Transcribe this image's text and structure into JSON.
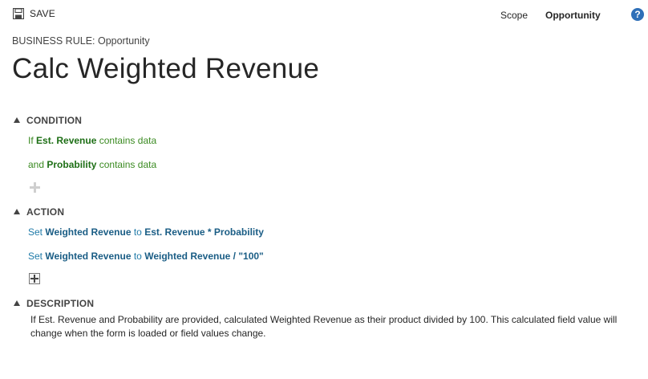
{
  "toolbar": {
    "save_label": "SAVE",
    "scope_label": "Scope",
    "scope_value": "Opportunity",
    "help_label": "?"
  },
  "breadcrumb": "BUSINESS RULE: Opportunity",
  "title": "Calc Weighted Revenue",
  "condition": {
    "header": "CONDITION",
    "lines": [
      {
        "prefix": "If",
        "field": "Est. Revenue",
        "operator": "contains data"
      },
      {
        "prefix": "and",
        "field": "Probability",
        "operator": "contains data"
      }
    ]
  },
  "action": {
    "header": "ACTION",
    "lines": [
      {
        "verb": "Set",
        "field": "Weighted Revenue",
        "joiner": "to",
        "value": "Est. Revenue * Probability"
      },
      {
        "verb": "Set",
        "field": "Weighted Revenue",
        "joiner": "to",
        "value": "Weighted Revenue / \"100\""
      }
    ]
  },
  "description": {
    "header": "DESCRIPTION",
    "text": "If Est. Revenue and Probability are provided, calculated Weighted Revenue as their product divided by 100. This calculated field value will change when the form is loaded or field values change."
  },
  "colors": {
    "condition_text": "#3a8a21",
    "action_text": "#1f7aa8",
    "help_icon": "#2e6fb8"
  },
  "icons": {
    "save": "save-icon",
    "help": "help-icon",
    "collapse": "collapse-triangle-icon",
    "add_condition": "plus-icon",
    "add_action": "add-action-icon"
  }
}
